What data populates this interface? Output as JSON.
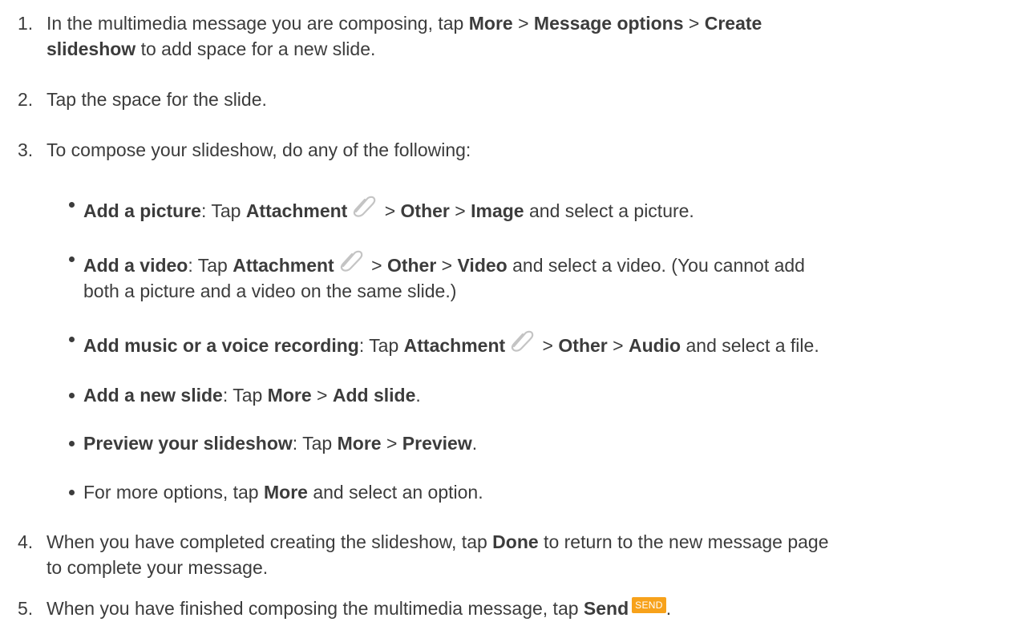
{
  "colors": {
    "text": "#3c3c3c",
    "send_badge_bg": "#f7a21b",
    "send_badge_text": "#ffffff",
    "icon_stroke": "#c4c4c4"
  },
  "icons": {
    "attachment": "paperclip-icon",
    "send": "send-badge-icon"
  },
  "steps": [
    {
      "num": "1.",
      "lines": [
        [
          "In the multimedia message you are composing, tap ",
          "More",
          " > ",
          "Message options",
          " > ",
          "Create"
        ],
        [
          "slideshow",
          " to add space for a new slide."
        ]
      ]
    },
    {
      "num": "2.",
      "text": "Tap the space for the slide."
    },
    {
      "num": "3.",
      "text": "To compose your slideshow, do any of the following:"
    },
    {
      "num": "4.",
      "lines": [
        [
          "When you have completed creating the slideshow, tap ",
          "Done",
          " to return to the new message page"
        ],
        [
          "to complete your message."
        ]
      ]
    },
    {
      "num": "5.",
      "parts": [
        "When you have finished composing the multimedia message, tap ",
        "Send",
        "."
      ],
      "send_label": "SEND"
    }
  ],
  "bullets": [
    {
      "parts": [
        "Add a picture",
        ": Tap ",
        "Attachment",
        " > ",
        "Other",
        " > ",
        "Image",
        " and select a picture."
      ]
    },
    {
      "parts": [
        "Add a video",
        ": Tap ",
        "Attachment",
        " > ",
        "Other",
        " > ",
        "Video",
        " and select a video. (You cannot add"
      ],
      "line2": "both a picture and a video on the same slide.)"
    },
    {
      "parts": [
        "Add music or a voice recording",
        ": Tap ",
        "Attachment",
        " > ",
        "Other",
        " > ",
        "Audio",
        " and select a file."
      ]
    },
    {
      "parts": [
        "Add a new slide",
        ": Tap ",
        "More",
        " > ",
        "Add slide",
        "."
      ]
    },
    {
      "parts": [
        "Preview your slideshow",
        ": Tap ",
        "More",
        " > ",
        "Preview",
        "."
      ]
    },
    {
      "parts": [
        "For more options, tap ",
        "More",
        " and select an option."
      ]
    }
  ]
}
